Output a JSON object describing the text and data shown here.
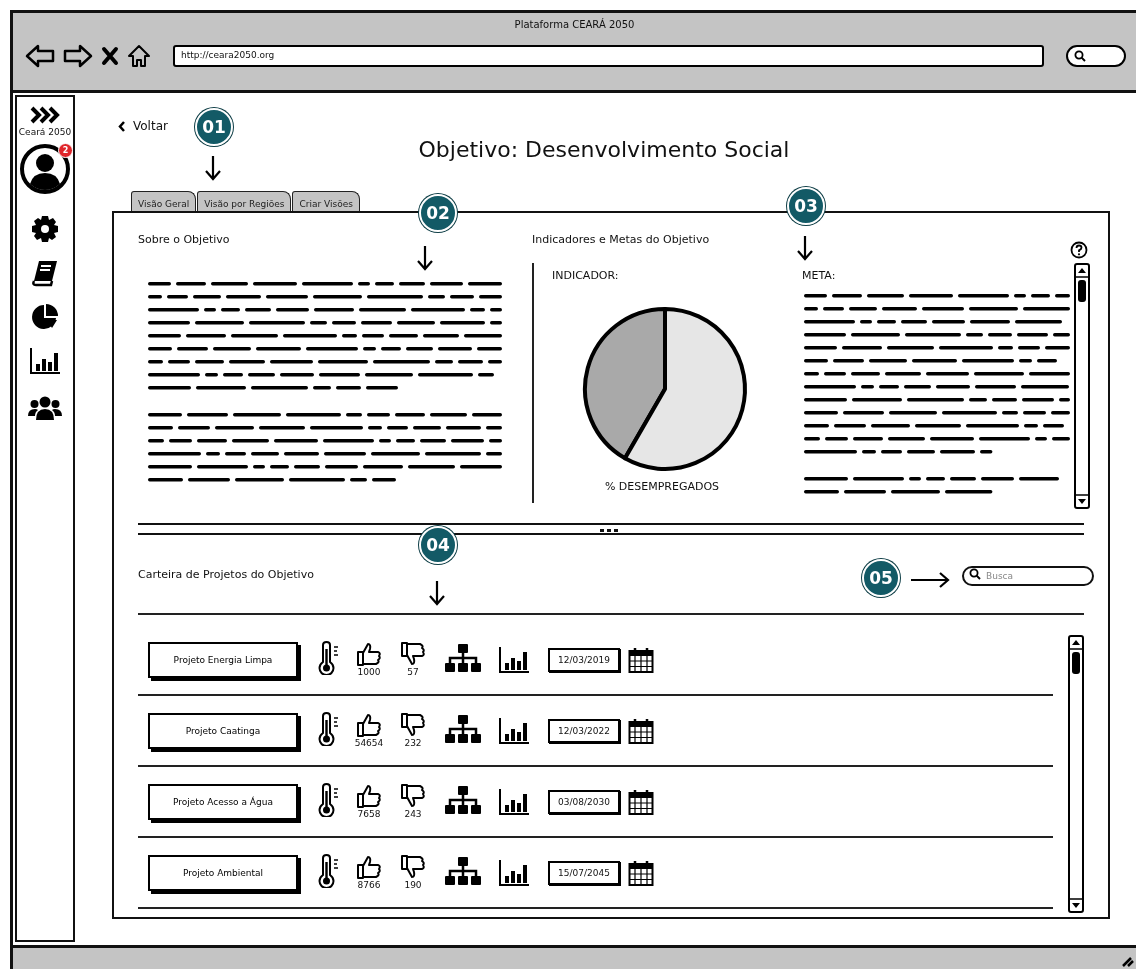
{
  "window": {
    "title": "Plataforma CEARÁ 2050",
    "url": "http://ceara2050.org"
  },
  "sidebar": {
    "brand": "Ceará 2050",
    "notification_count": "2"
  },
  "back_link": "Voltar",
  "page_title": "Objetivo: Desenvolvimento Social",
  "tabs": [
    {
      "label": "Visão Geral",
      "selected": false
    },
    {
      "label": "Visão por Regiões",
      "selected": false
    },
    {
      "label": "Criar Visões",
      "selected": false
    }
  ],
  "about": {
    "title": "Sobre o Objetivo"
  },
  "indicators": {
    "title": "Indicadores e Metas do Objetivo",
    "indicator_label": "INDICADOR:",
    "chart_caption": "% DESEMPREGADOS",
    "goal_label": "META:"
  },
  "projects": {
    "title": "Carteira de Projetos do Objetivo",
    "search": {
      "placeholder": "Busca"
    },
    "rows": [
      {
        "name": "Projeto Energia Limpa",
        "likes": "1000",
        "dislikes": "57",
        "date": "12/03/2019"
      },
      {
        "name": "Projeto Caatinga",
        "likes": "54654",
        "dislikes": "232",
        "date": "12/03/2022"
      },
      {
        "name": "Projeto Acesso a Água",
        "likes": "7658",
        "dislikes": "243",
        "date": "03/08/2030"
      },
      {
        "name": "Projeto Ambiental",
        "likes": "8766",
        "dislikes": "190",
        "date": "15/07/2045"
      }
    ]
  },
  "callouts": [
    "01",
    "02",
    "03",
    "04",
    "05"
  ]
}
